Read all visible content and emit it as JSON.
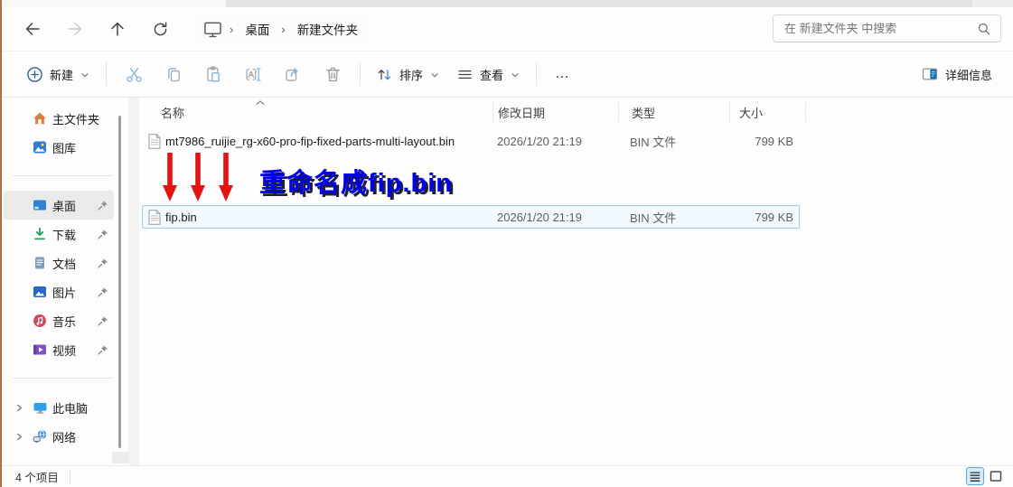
{
  "navbar": {
    "breadcrumb": {
      "items": [
        "桌面",
        "新建文件夹"
      ]
    },
    "search_placeholder": "在 新建文件夹 中搜索"
  },
  "toolbar": {
    "new_label": "新建",
    "sort_label": "排序",
    "view_label": "查看",
    "more_label": "…",
    "details_label": "详细信息"
  },
  "sidebar": {
    "items": [
      {
        "label": "主文件夹",
        "icon": "home-icon",
        "pinned": false,
        "selected": false
      },
      {
        "label": "图库",
        "icon": "gallery-icon",
        "pinned": false,
        "selected": false
      },
      {
        "label": "桌面",
        "icon": "desktop-icon",
        "pinned": true,
        "selected": true
      },
      {
        "label": "下载",
        "icon": "download-icon",
        "pinned": true,
        "selected": false
      },
      {
        "label": "文档",
        "icon": "document-icon",
        "pinned": true,
        "selected": false
      },
      {
        "label": "图片",
        "icon": "pictures-icon",
        "pinned": true,
        "selected": false
      },
      {
        "label": "音乐",
        "icon": "music-icon",
        "pinned": true,
        "selected": false
      },
      {
        "label": "视频",
        "icon": "videos-icon",
        "pinned": true,
        "selected": false
      },
      {
        "label": "此电脑",
        "icon": "this-pc-icon",
        "pinned": false,
        "selected": false
      },
      {
        "label": "网络",
        "icon": "network-icon",
        "pinned": false,
        "selected": false
      }
    ]
  },
  "filelist": {
    "columns": [
      {
        "label": "名称"
      },
      {
        "label": "修改日期"
      },
      {
        "label": "类型"
      },
      {
        "label": "大小"
      }
    ],
    "rows": [
      {
        "name": "mt7986_ruijie_rg-x60-pro-fip-fixed-parts-multi-layout.bin",
        "modified": "2026/1/20 21:19",
        "type": "BIN 文件",
        "size": "799 KB",
        "selected": false
      },
      {
        "name": "fip.bin",
        "modified": "2026/1/20 21:19",
        "type": "BIN 文件",
        "size": "799 KB",
        "selected": true
      }
    ]
  },
  "annotation": {
    "text": "重命名成fip.bin",
    "text_color": "#0000ee",
    "arrow_color": "#e51212"
  },
  "statusbar": {
    "items_text": "4 个项目"
  },
  "colors": {
    "selection_border": "#9dc9e6",
    "selection_bg": "#f2f9fe",
    "toolbar_icon_blue": "#7fb2dd",
    "toolbar_icon_gray": "#a6a6a6",
    "accent_blue": "#0f6cbd",
    "sidebar_selected_bg": "#eaeaea"
  }
}
